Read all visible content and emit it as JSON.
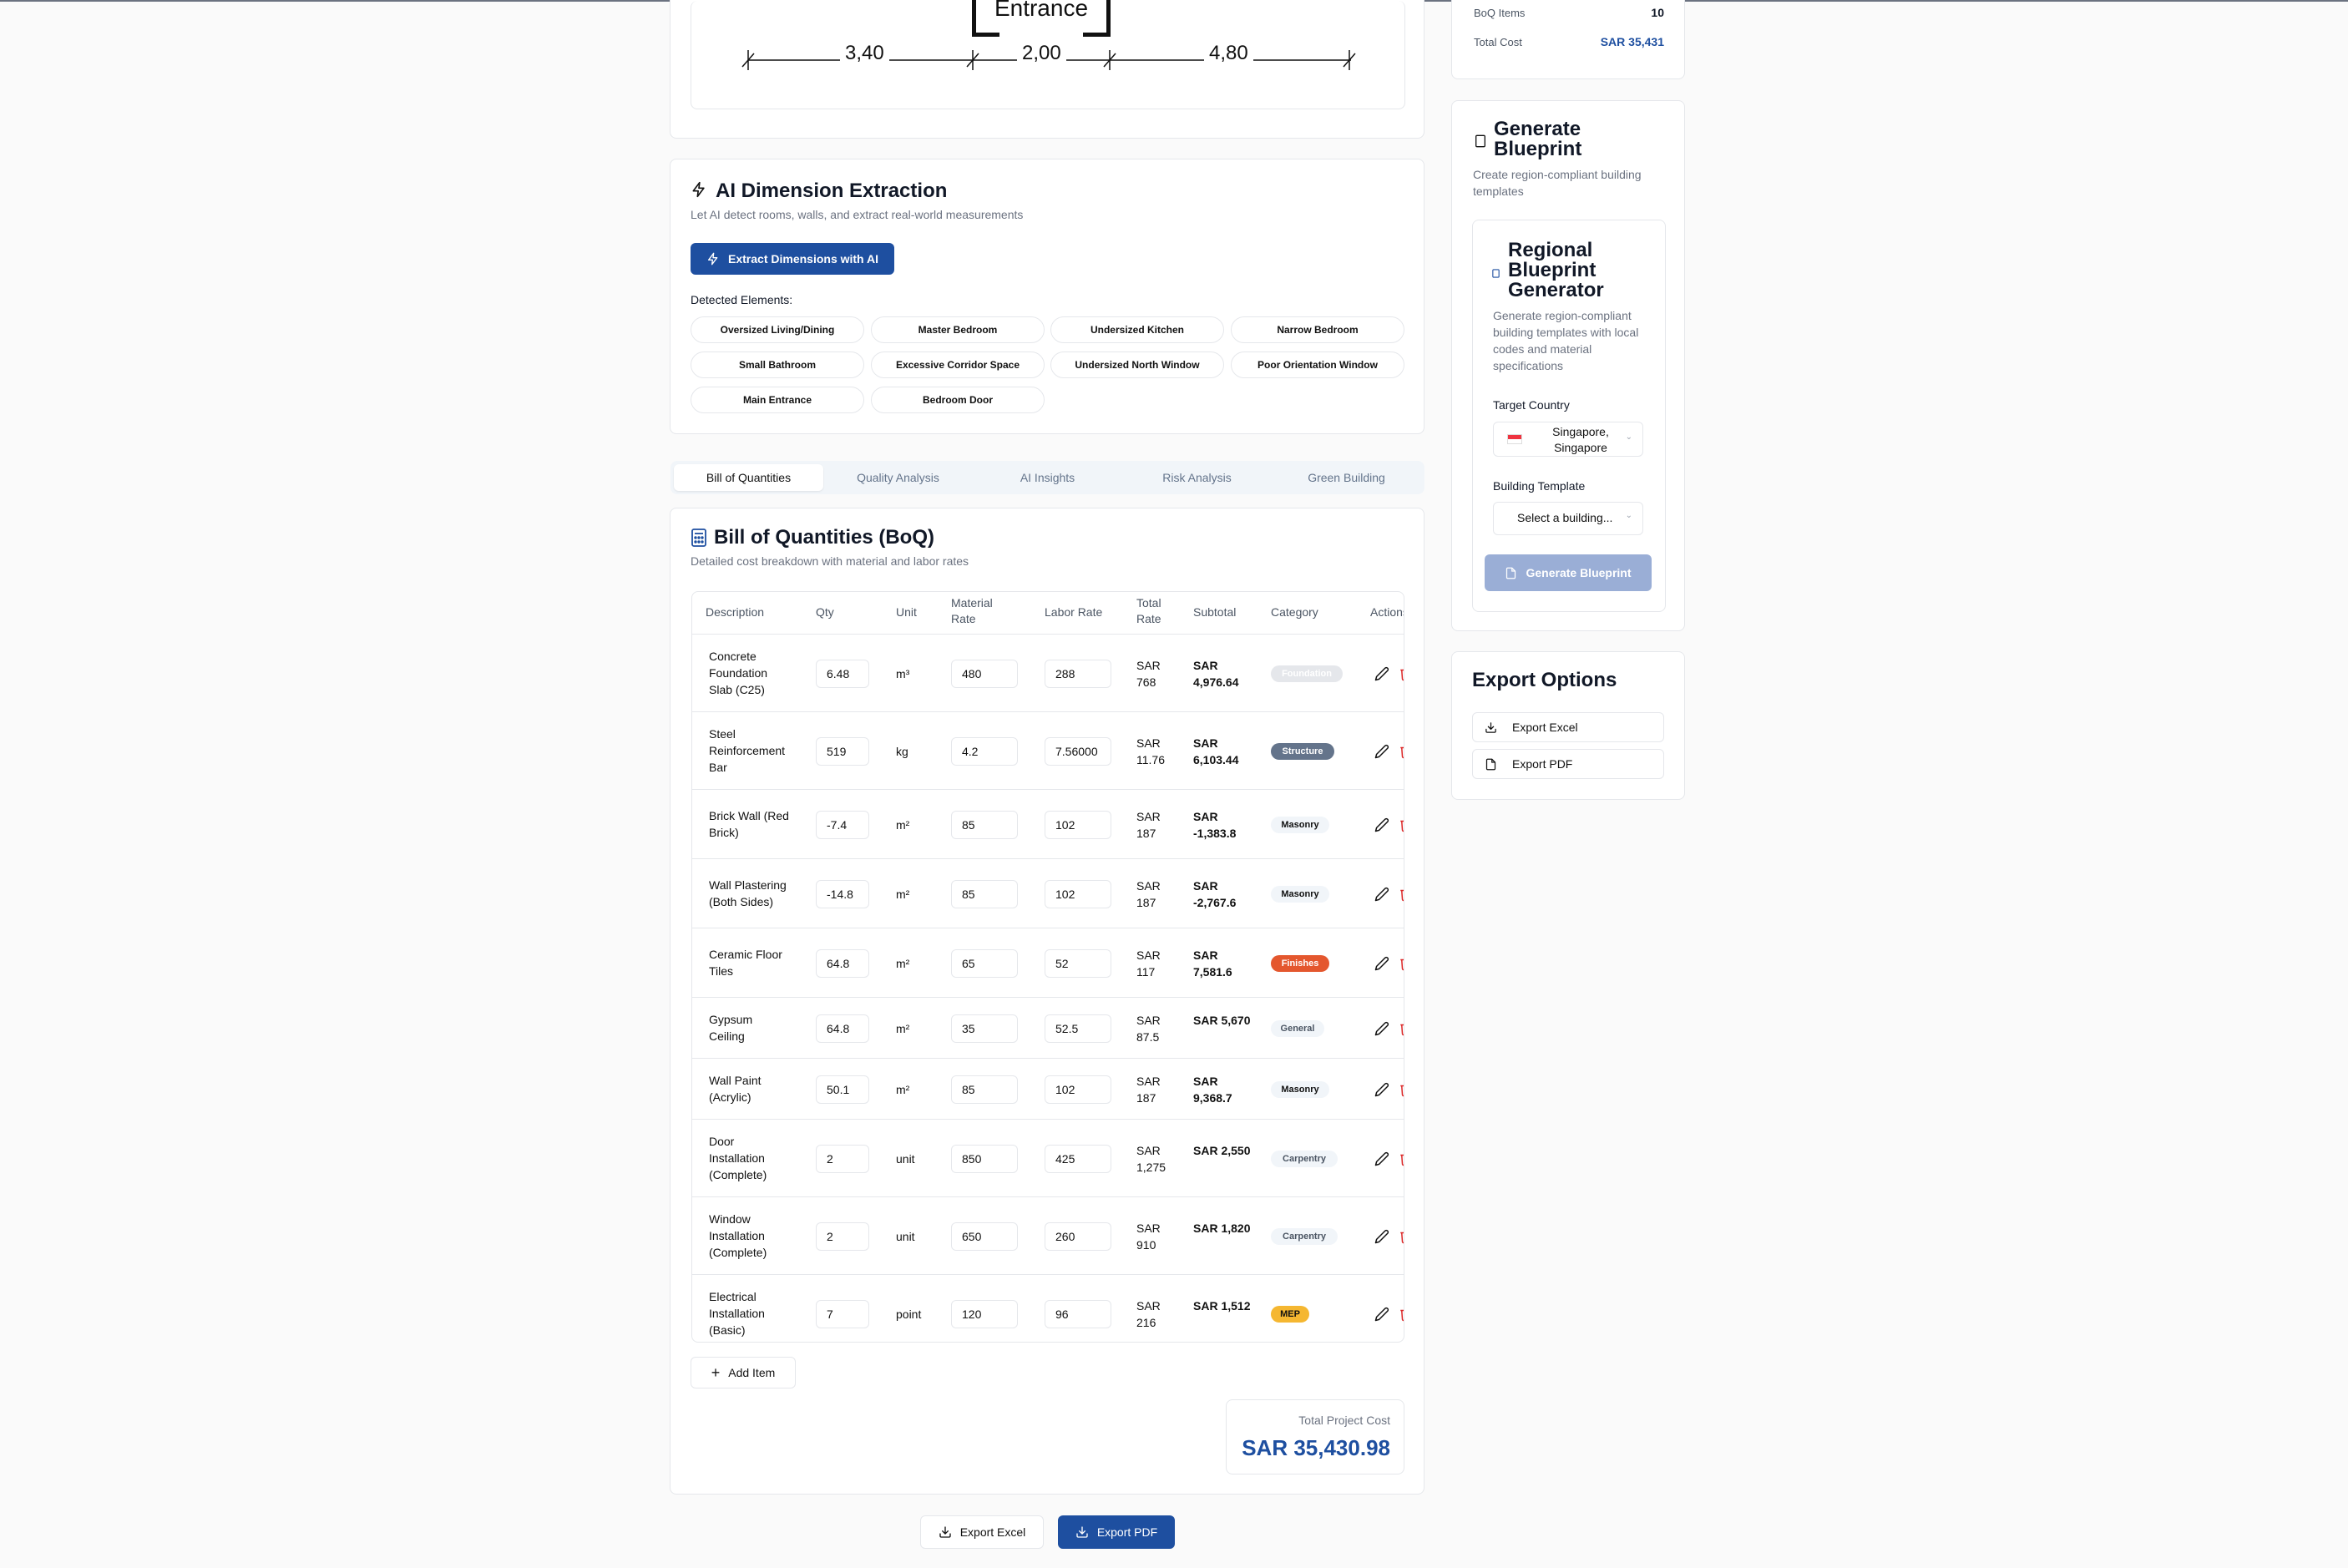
{
  "floorplan": {
    "entrance_label": "Entrance",
    "dims": [
      "3,40",
      "2,00",
      "4,80"
    ]
  },
  "ai_extraction": {
    "title": "AI Dimension Extraction",
    "subtitle": "Let AI detect rooms, walls, and extract real-world measurements",
    "button": "Extract Dimensions with AI",
    "detected_label": "Detected Elements:",
    "elements": [
      "Oversized Living/Dining",
      "Master Bedroom",
      "Undersized Kitchen",
      "Narrow Bedroom",
      "Small Bathroom",
      "Excessive Corridor Space",
      "Undersized North Window",
      "Poor Orientation Window",
      "Main Entrance",
      "Bedroom Door"
    ]
  },
  "tabs": [
    "Bill of Quantities",
    "Quality Analysis",
    "AI Insights",
    "Risk Analysis",
    "Green Building"
  ],
  "boq": {
    "title": "Bill of Quantities (BoQ)",
    "subtitle": "Detailed cost breakdown with material and labor rates",
    "headers": {
      "description": "Description",
      "qty": "Qty",
      "unit": "Unit",
      "material_rate": "Material Rate",
      "labor_rate": "Labor Rate",
      "total_rate": "Total Rate",
      "subtotal": "Subtotal",
      "category": "Category",
      "actions": "Actions"
    },
    "rows": [
      {
        "desc": "Concrete Foundation Slab (C25)",
        "qty": "6.48",
        "unit": "m³",
        "mat": "480",
        "lab": "288",
        "total": "SAR 768",
        "sub": "SAR 4,976.64",
        "cat": "Foundation"
      },
      {
        "desc": "Steel Reinforcement Bar",
        "qty": "519",
        "unit": "kg",
        "mat": "4.2",
        "lab": "7.56000",
        "total": "SAR 11.76",
        "sub": "SAR 6,103.44",
        "cat": "Structure"
      },
      {
        "desc": "Brick Wall (Red Brick)",
        "qty": "-7.4",
        "unit": "m²",
        "mat": "85",
        "lab": "102",
        "total": "SAR 187",
        "sub": "SAR -1,383.8",
        "cat": "Masonry"
      },
      {
        "desc": "Wall Plastering (Both Sides)",
        "qty": "-14.8",
        "unit": "m²",
        "mat": "85",
        "lab": "102",
        "total": "SAR 187",
        "sub": "SAR -2,767.6",
        "cat": "Masonry"
      },
      {
        "desc": "Ceramic Floor Tiles",
        "qty": "64.8",
        "unit": "m²",
        "mat": "65",
        "lab": "52",
        "total": "SAR 117",
        "sub": "SAR 7,581.6",
        "cat": "Finishes"
      },
      {
        "desc": "Gypsum Ceiling",
        "qty": "64.8",
        "unit": "m²",
        "mat": "35",
        "lab": "52.5",
        "total": "SAR 87.5",
        "sub": "SAR 5,670",
        "cat": "General"
      },
      {
        "desc": "Wall Paint (Acrylic)",
        "qty": "50.1",
        "unit": "m²",
        "mat": "85",
        "lab": "102",
        "total": "SAR 187",
        "sub": "SAR 9,368.7",
        "cat": "Masonry"
      },
      {
        "desc": "Door Installation (Complete)",
        "qty": "2",
        "unit": "unit",
        "mat": "850",
        "lab": "425",
        "total": "SAR 1,275",
        "sub": "SAR 2,550",
        "cat": "Carpentry"
      },
      {
        "desc": "Window Installation (Complete)",
        "qty": "2",
        "unit": "unit",
        "mat": "650",
        "lab": "260",
        "total": "SAR 910",
        "sub": "SAR 1,820",
        "cat": "Carpentry"
      },
      {
        "desc": "Electrical Installation (Basic)",
        "qty": "7",
        "unit": "point",
        "mat": "120",
        "lab": "96",
        "total": "SAR 216",
        "sub": "SAR 1,512",
        "cat": "MEP"
      }
    ],
    "add_item": "Add Item",
    "total_label": "Total Project Cost",
    "total_value": "SAR 35,430.98"
  },
  "bottom_buttons": {
    "excel": "Export Excel",
    "pdf": "Export PDF"
  },
  "summary": {
    "items_label": "BoQ Items",
    "items_value": "10",
    "cost_label": "Total Cost",
    "cost_value": "SAR 35,431"
  },
  "generate": {
    "title": "Generate Blueprint",
    "subtitle": "Create region-compliant building templates",
    "inner_title": "Regional Blueprint Generator",
    "inner_subtitle": "Generate region-compliant building templates with local codes and material specifications",
    "country_label": "Target Country",
    "country_value": "Singapore, Singapore",
    "template_label": "Building Template",
    "template_placeholder": "Select a building...",
    "button": "Generate Blueprint"
  },
  "export_options": {
    "title": "Export Options",
    "excel": "Export Excel",
    "pdf": "Export PDF"
  },
  "colors": {
    "primary": "#1e4fa0",
    "foundation_badge": "#e5e7eb",
    "structure_badge": "#64748b",
    "finishes_badge": "#e4572e",
    "mep_badge": "#f5b731"
  }
}
